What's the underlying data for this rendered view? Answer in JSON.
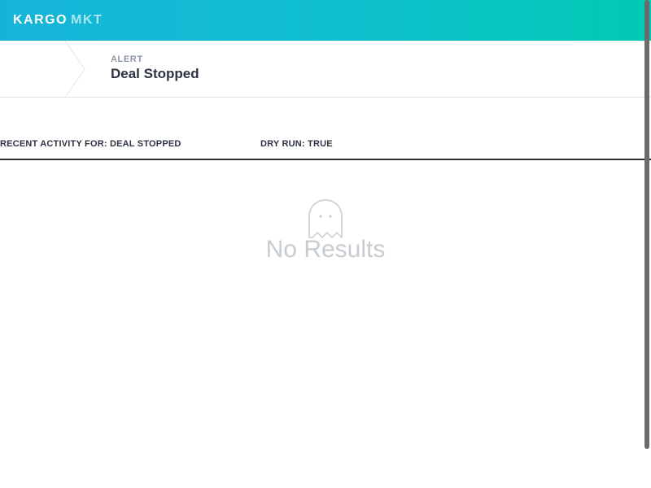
{
  "app": {
    "logo_brand": "KARGO",
    "logo_sub": "MKT"
  },
  "header": {
    "kicker": "ALERT",
    "title": "Deal Stopped"
  },
  "activity": {
    "recent_label": "RECENT ACTIVITY FOR: DEAL STOPPED",
    "dry_run_label": "DRY RUN: TRUE"
  },
  "empty_state": {
    "icon": "ghost-icon",
    "message": "No Results"
  },
  "colors": {
    "gradient_start": "#16b3d9",
    "gradient_end": "#00c9b3",
    "muted_text": "#c7ccd2",
    "title_text": "#2b3440"
  }
}
